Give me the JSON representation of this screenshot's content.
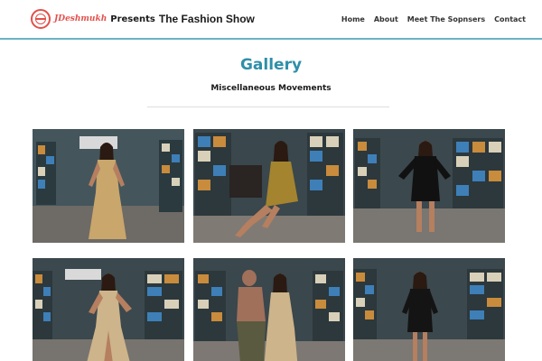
{
  "header": {
    "brand": "JDeshmukh",
    "presents": "Presents",
    "show_title": "The Fashion Show",
    "logo_icon": "globe-logo-icon",
    "accent_color": "#e2504b",
    "border_color": "#6bb3c4"
  },
  "nav": {
    "items": [
      {
        "label": "Home"
      },
      {
        "label": "About"
      },
      {
        "label": "Meet The Sopnsers"
      },
      {
        "label": "Contact"
      }
    ]
  },
  "gallery": {
    "title": "Gallery",
    "subtitle": "Miscellaneous Movements",
    "title_color": "#2e8fa8"
  }
}
